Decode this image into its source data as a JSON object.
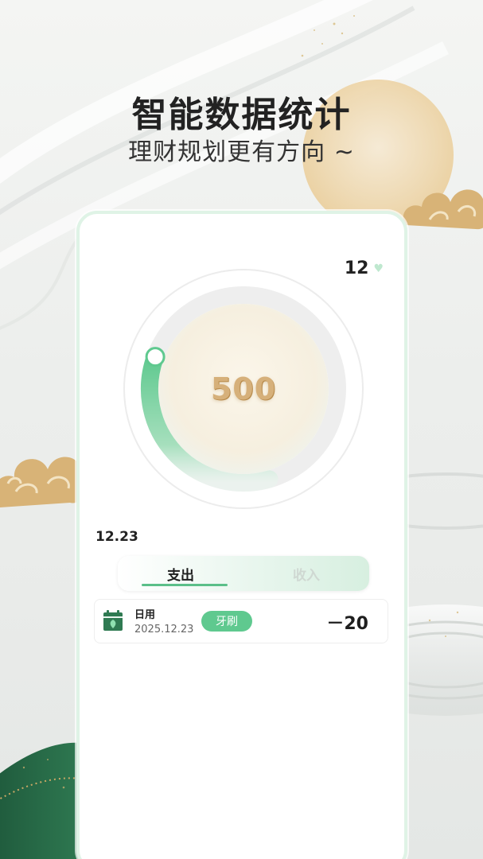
{
  "promo": {
    "headline": "智能数据统计",
    "subline": "理财规划更有方向 ~"
  },
  "card": {
    "month_selector": {
      "value": "12",
      "icon": "heart-dropdown-icon"
    },
    "gauge": {
      "value": "500",
      "progress": 0.35,
      "track_color": "#eeeeee",
      "fill_color": "#5fc98f"
    },
    "date_label": "12.23",
    "tabs": [
      {
        "label": "支出",
        "active": true
      },
      {
        "label": "收入",
        "active": false
      }
    ],
    "records": [
      {
        "category": "日用",
        "date": "2025.12.23",
        "tag": "牙刷",
        "amount": "－20",
        "icon": "calendar-plant-icon"
      }
    ]
  },
  "colors": {
    "accent": "#5fc98f",
    "gold": "#d6b07a",
    "card_border": "#dff3e6"
  }
}
